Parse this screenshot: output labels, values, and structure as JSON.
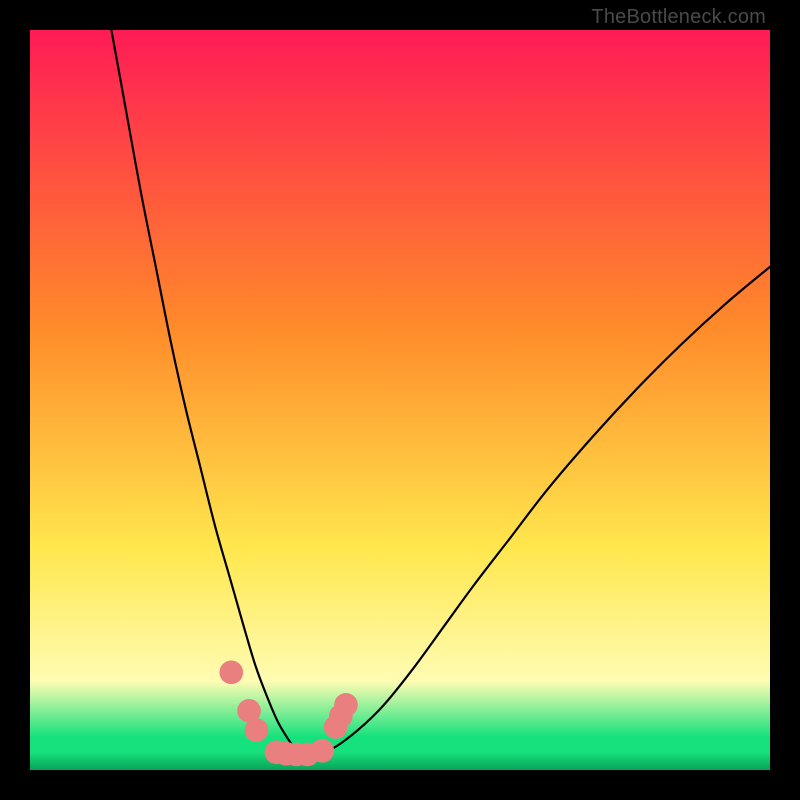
{
  "watermark": "TheBottleneck.com",
  "colors": {
    "top": "#ff1b55",
    "mid1": "#ff8a2a",
    "mid2": "#ffe74d",
    "pale": "#fffcb3",
    "green": "#16e27d",
    "dark_green": "#0aa358",
    "frame": "#000000",
    "curve": "#000000",
    "markers": "#e97f7f"
  },
  "chart_data": {
    "type": "line",
    "title": "",
    "xlabel": "",
    "ylabel": "",
    "xlim": [
      0,
      100
    ],
    "ylim": [
      0,
      100
    ],
    "series": [
      {
        "name": "bottleneck-curve",
        "x": [
          11,
          13,
          15,
          17,
          19,
          21,
          23,
          25,
          27,
          29,
          30.5,
          32,
          33.5,
          35,
          36,
          37,
          38,
          40,
          42,
          45,
          48,
          52,
          56,
          60,
          65,
          70,
          76,
          82,
          88,
          94,
          100
        ],
        "y": [
          100,
          89,
          78,
          68,
          58,
          49,
          41,
          33,
          26,
          19,
          14,
          10,
          6.5,
          4,
          2.6,
          2.1,
          2.1,
          2.5,
          3.6,
          6,
          9,
          14,
          19.5,
          25,
          31.5,
          38,
          45,
          51.5,
          57.5,
          63,
          68
        ]
      }
    ],
    "markers": [
      {
        "x": 27.2,
        "y": 13.2,
        "r": 1.6
      },
      {
        "x": 29.6,
        "y": 8.0,
        "r": 1.6
      },
      {
        "x": 30.6,
        "y": 5.4,
        "r": 1.6
      },
      {
        "x": 33.3,
        "y": 2.4,
        "r": 1.6
      },
      {
        "x": 34.6,
        "y": 2.2,
        "r": 1.6
      },
      {
        "x": 36.0,
        "y": 2.1,
        "r": 1.6
      },
      {
        "x": 37.5,
        "y": 2.1,
        "r": 1.6
      },
      {
        "x": 39.5,
        "y": 2.6,
        "r": 1.6
      },
      {
        "x": 41.3,
        "y": 5.8,
        "r": 1.6
      },
      {
        "x": 42.0,
        "y": 7.3,
        "r": 1.6
      },
      {
        "x": 42.7,
        "y": 8.8,
        "r": 1.6
      }
    ],
    "gradient_stops": [
      {
        "offset": 0.0,
        "key": "top"
      },
      {
        "offset": 0.4,
        "key": "mid1"
      },
      {
        "offset": 0.7,
        "key": "mid2"
      },
      {
        "offset": 0.88,
        "key": "pale"
      },
      {
        "offset": 0.955,
        "key": "green"
      },
      {
        "offset": 0.975,
        "key": "green"
      },
      {
        "offset": 1.0,
        "key": "dark_green"
      }
    ]
  }
}
